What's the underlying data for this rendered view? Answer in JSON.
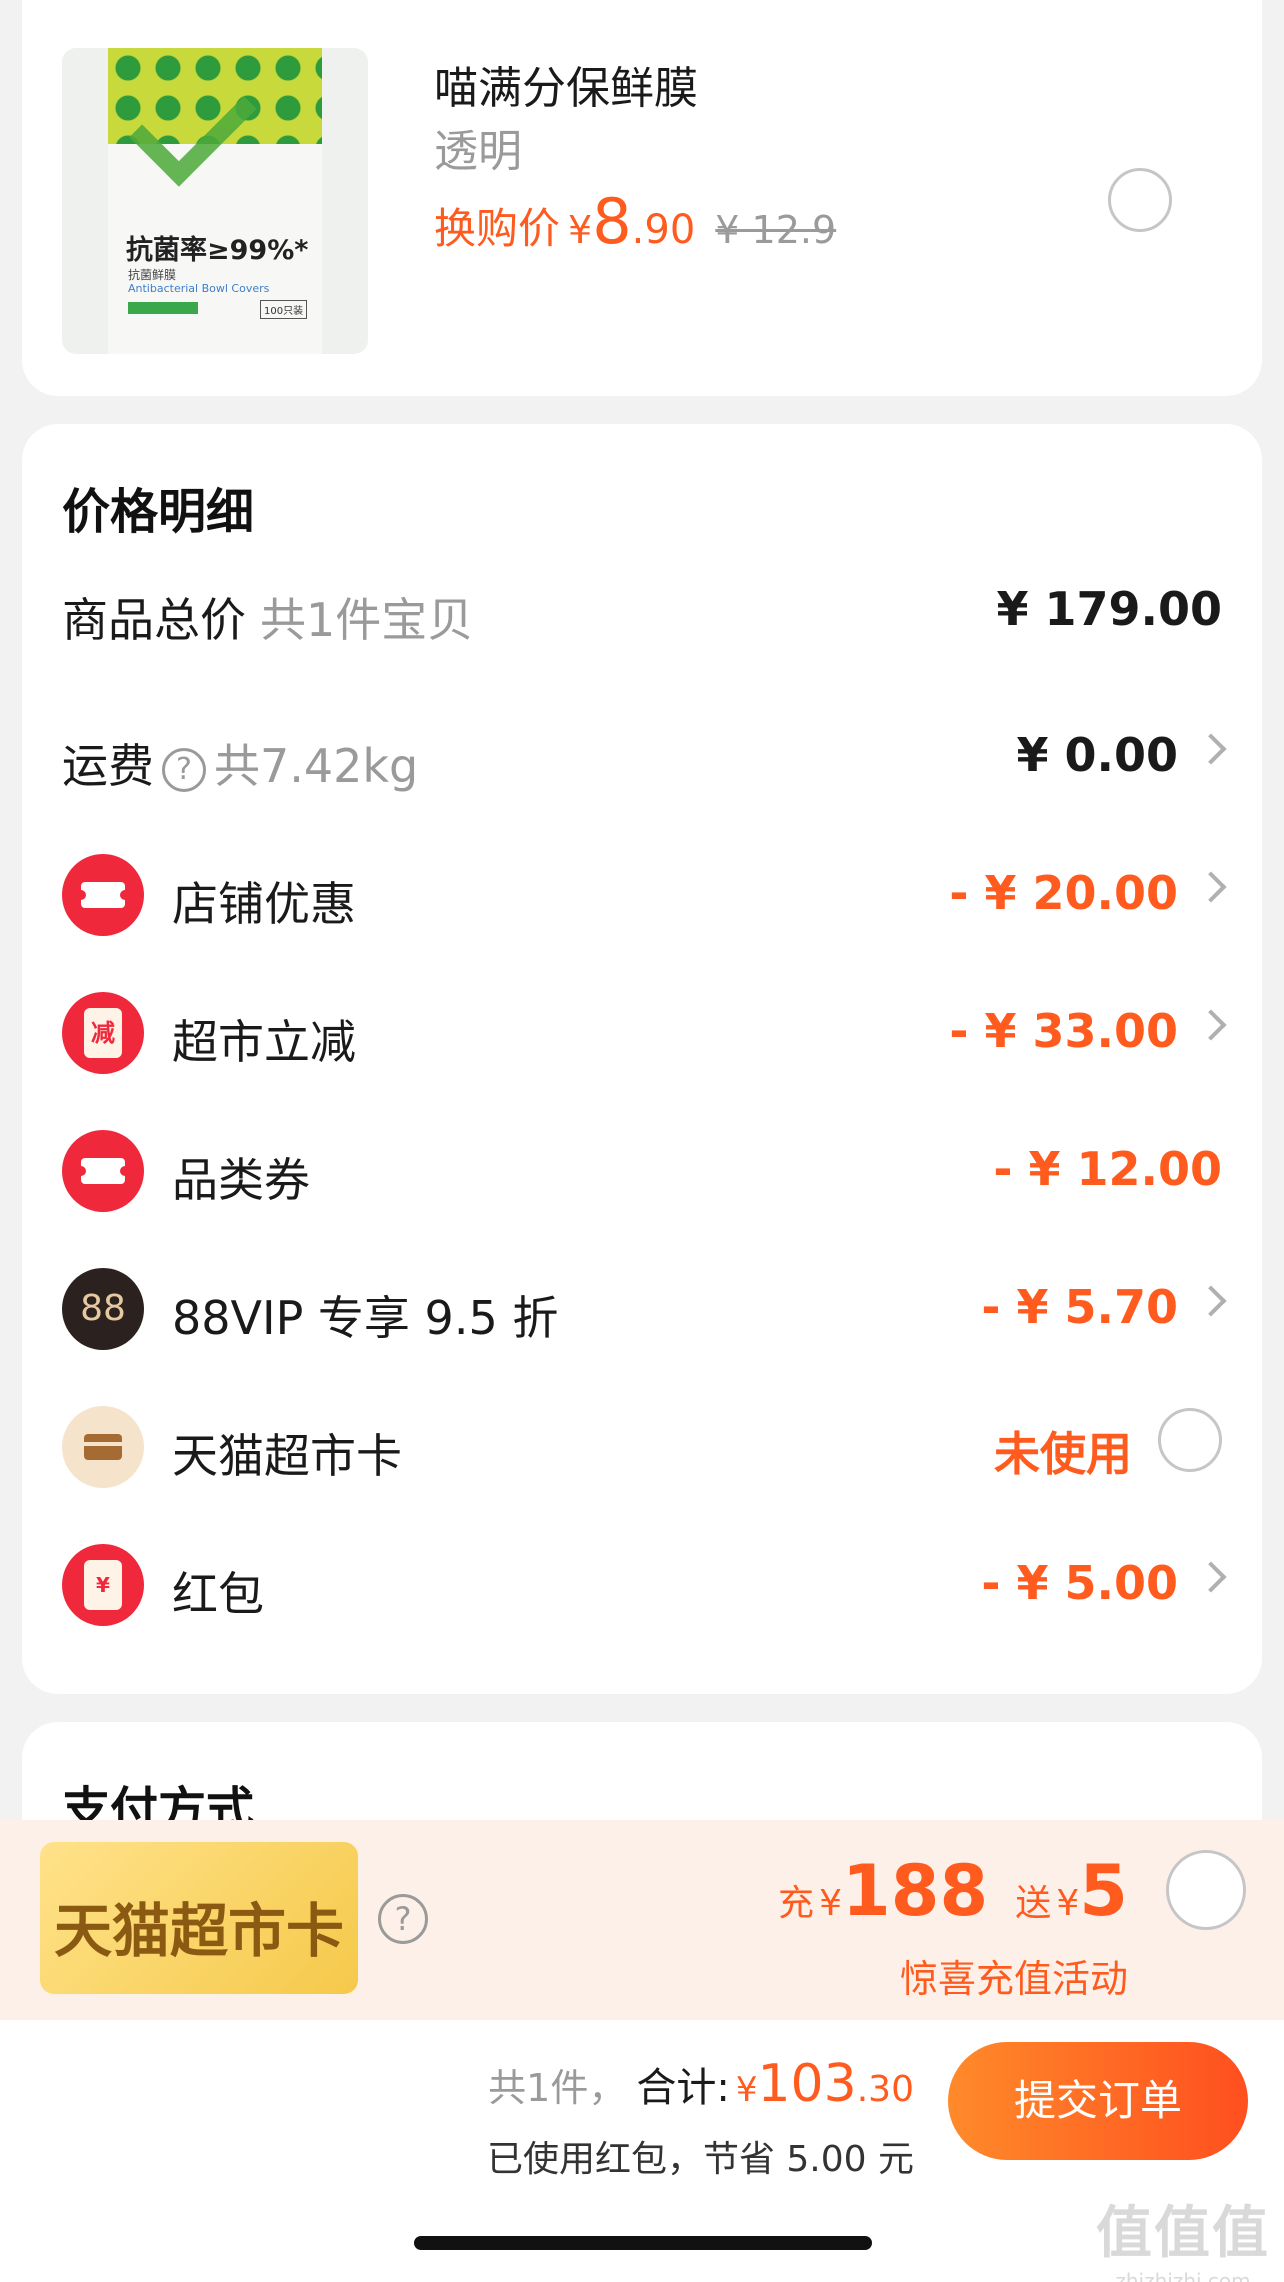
{
  "addon_item": {
    "image_text": "抗菌率≥99%*",
    "image_sub": "抗菌鲜膜",
    "image_en": "Antibacterial Bowl Covers",
    "image_count": "100只装",
    "name": "喵满分保鲜膜",
    "spec": "透明",
    "price_label": "换购价",
    "currency": "¥",
    "price_int": "8",
    "price_dec": ".90",
    "original_price": "¥ 12.9"
  },
  "price_detail": {
    "title": "价格明细",
    "rows": [
      {
        "label": "商品总价",
        "sub": "共1件宝贝",
        "value": "¥ 179.00"
      },
      {
        "label": "运费",
        "sub": "共7.42kg",
        "value": "¥ 0.00"
      },
      {
        "label": "店铺优惠",
        "value": "- ¥ 20.00",
        "icon": "coupon-ticket-icon"
      },
      {
        "label": "超市立减",
        "value": "- ¥ 33.00",
        "icon": "supermarket-discount-icon",
        "icon_text": "减"
      },
      {
        "label": "品类券",
        "value": "- ¥ 12.00",
        "icon": "coupon-ticket-icon"
      },
      {
        "label": "88VIP 专享 9.5 折",
        "value": "- ¥ 5.70",
        "icon": "88vip-icon",
        "icon_text": "88"
      },
      {
        "label": "天猫超市卡",
        "value": "未使用",
        "icon": "card-icon"
      },
      {
        "label": "红包",
        "value": "- ¥ 5.00",
        "icon": "red-packet-icon",
        "icon_text": "¥"
      }
    ],
    "help_symbol": "?"
  },
  "payment": {
    "title": "支付方式"
  },
  "promo": {
    "badge": "天猫超市卡",
    "help_symbol": "?",
    "charge_label": "充",
    "currency": "¥",
    "charge_amount": "188",
    "bonus_label": "送",
    "bonus_amount": "5",
    "subtitle": "惊喜充值活动"
  },
  "checkout": {
    "count_text": "共1件，",
    "total_label": "合计:",
    "currency": "¥",
    "total_int": "103",
    "total_dec": ".30",
    "saved_text": "已使用红包，节省 5.00 元",
    "submit_label": "提交订单"
  },
  "watermark": {
    "big": "值值值",
    "small": "zhizhizhi.com"
  },
  "colors": {
    "accent": "#ff5b1e",
    "coupon_red": "#f0283c",
    "background": "#f2f2f2"
  }
}
